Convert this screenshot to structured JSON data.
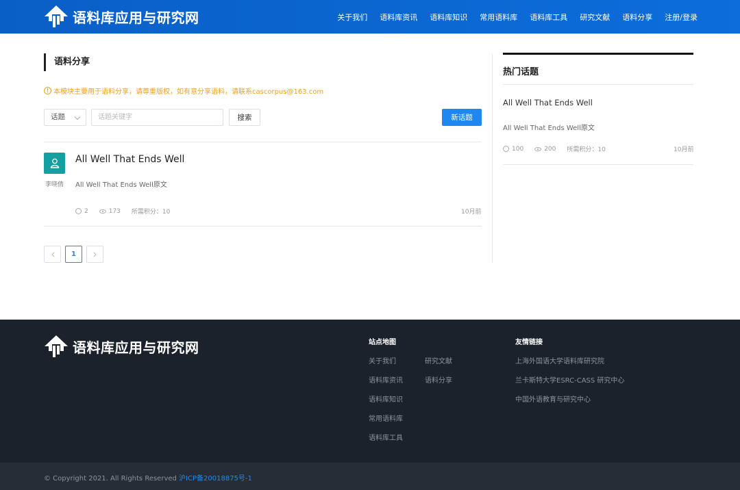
{
  "header": {
    "site_name": "语料库应用与研究网",
    "nav": [
      "关于我们",
      "语料库资讯",
      "语料库知识",
      "常用语料库",
      "语料库工具",
      "研究文献",
      "语料分享",
      "注册/登录"
    ]
  },
  "main": {
    "section_title": "语料分享",
    "notice": "本模块主要用于语料分享，请尊重版权，如有意分享语料，请联系cascorpus@163.com",
    "filter": {
      "selected": "话题"
    },
    "search": {
      "placeholder": "话题关键字",
      "button": "搜索"
    },
    "new_topic_button": "新话题",
    "posts": [
      {
        "author": "李晓倩",
        "title": "All Well That Ends Well",
        "excerpt": "All Well That Ends Well原文",
        "comments": "2",
        "views": "173",
        "points": "所需积分：10",
        "time": "10月前"
      }
    ],
    "pagination": {
      "prev": "<",
      "current": "1",
      "next": ">"
    }
  },
  "sidebar": {
    "title": "热门话题",
    "posts": [
      {
        "title": "All Well That Ends Well",
        "excerpt": "All Well That Ends Well原文",
        "comments": "100",
        "views": "200",
        "points": "所需积分：10",
        "time": "10月前"
      }
    ]
  },
  "footer": {
    "site_name": "语料库应用与研究网",
    "sitemap_title": "站点地图",
    "sitemap_col1": [
      "关于我们",
      "语料库资讯",
      "语料库知识",
      "常用语料库",
      "语料库工具"
    ],
    "sitemap_col2": [
      "研究文献",
      "语料分享"
    ],
    "friends_title": "友情链接",
    "friends": [
      "上海外国语大学语料库研究院",
      "兰卡斯特大学ESRC-CASS 研究中心",
      "中国外语教育与研究中心"
    ],
    "copyright": "© Copyright 2021. All Rights Reserved",
    "icp": "沪ICP备20018875号-1"
  },
  "colors": {
    "header_blue": "#0c6ddb",
    "accent_blue": "#1e88f0",
    "notice_orange": "#f0a020",
    "avatar_teal": "#14a0a0",
    "footer_dark": "#1b222b"
  }
}
